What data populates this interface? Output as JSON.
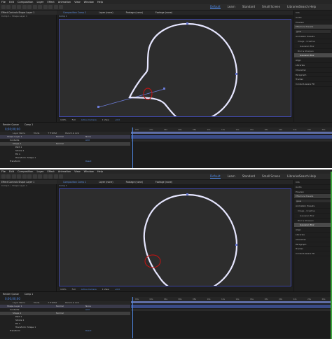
{
  "app": {
    "menu": [
      "File",
      "Edit",
      "Composition",
      "Layer",
      "Effect",
      "Animation",
      "View",
      "Window",
      "Help"
    ],
    "workspaces": [
      "Default",
      "Learn",
      "Standard",
      "Small Screen",
      "Libraries"
    ],
    "search_help": "Search Help"
  },
  "screens": [
    {
      "project_tab": "Effect Controls Shape Layer 1",
      "project_sub": "Comp 1 • Shape Layer 1",
      "comp_tabs": [
        "Composition Comp 1",
        "Layer (none)",
        "Footage (none)",
        "Footage (none)"
      ],
      "comp_sub": "Comp 1",
      "viewer_bar": [
        "100%",
        "Full",
        "Active Camera",
        "1 View",
        "+0.0"
      ],
      "right_panel": [
        "Info",
        "Audio",
        "Preview",
        "Effects & Presets",
        "gaus",
        "Animation Presets",
        "Image - Creative",
        "Gaussian Blur",
        "Blur & Sharpen",
        "Gaussian Blur",
        "Align",
        "Libraries",
        "Character",
        "Paragraph",
        "Tracker",
        "Content-Aware Fill"
      ],
      "timeline_tabs": [
        "Render Queue",
        "Comp 1"
      ],
      "timecode": "0;00;00;00",
      "columns": [
        "Layer Name",
        "Mode",
        "T TrkMat",
        "Parent & Link"
      ],
      "layers": [
        "Shape Layer 1",
        "Contents",
        "Shape 1",
        "Path 1",
        "Stroke 1",
        "Fill 1",
        "Transform: Shape 1",
        "Transform"
      ],
      "layer_mode": "Normal",
      "layer_parent": "None",
      "value_add": "Add",
      "value_reset": "Reset",
      "ruler": [
        "00s",
        "02s",
        "04s",
        "06s",
        "08s",
        "10s",
        "12s",
        "14s",
        "16s",
        "18s",
        "20s",
        "22s",
        "24s",
        "26s"
      ]
    },
    {
      "project_tab": "Effect Controls Shape Layer 1",
      "project_sub": "Comp 1 • Shape Layer 1",
      "comp_tabs": [
        "Composition Comp 1",
        "Layer (none)",
        "Footage (none)",
        "Footage (none)"
      ],
      "comp_sub": "Comp 1",
      "viewer_bar": [
        "100%",
        "Full",
        "Active Camera",
        "1 View",
        "+0.0"
      ],
      "right_panel": [
        "Info",
        "Audio",
        "Preview",
        "Effects & Presets",
        "gaus",
        "Animation Presets",
        "Image - Creative",
        "Gaussian Blur",
        "Blur & Sharpen",
        "Gaussian Blur",
        "Align",
        "Libraries",
        "Character",
        "Paragraph",
        "Tracker",
        "Content-Aware Fill"
      ],
      "timeline_tabs": [
        "Render Queue",
        "Comp 1"
      ],
      "timecode": "0;00;00;00",
      "columns": [
        "Layer Name",
        "Mode",
        "T TrkMat",
        "Parent & Link"
      ],
      "layers": [
        "Shape Layer 1",
        "Contents",
        "Shape 1",
        "Path 1",
        "Stroke 1",
        "Fill 1",
        "Transform: Shape 1",
        "Transform"
      ],
      "layer_mode": "Normal",
      "layer_parent": "None",
      "value_add": "Add",
      "value_reset": "Reset",
      "ruler": [
        "00s",
        "02s",
        "04s",
        "06s",
        "08s",
        "10s",
        "12s",
        "14s",
        "16s",
        "18s",
        "20s",
        "22s",
        "24s",
        "26s"
      ]
    }
  ],
  "colors": {
    "accent": "#4e86df",
    "selection_frame": "#3f47a3",
    "shape_stroke": "#e6e6ff",
    "annotation": "#cc1111"
  }
}
